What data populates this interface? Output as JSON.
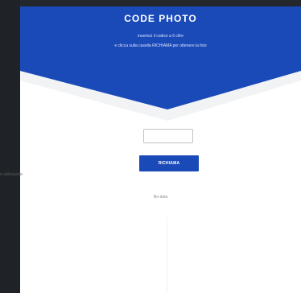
{
  "header": {
    "title": "CODE PHOTO",
    "instruction_line1": "inserisci il codice a 6 cifre",
    "instruction_line2": "e clicca sulla casella RICHIAMA per ottenere la foto"
  },
  "form": {
    "code_value": "",
    "submit_label": "RICHIAMA"
  },
  "status": {
    "text": "No data"
  },
  "side_caption": "e utilizzando",
  "colors": {
    "hero_blue": "#1a49b8",
    "button_blue": "#1a49b8",
    "background_dark": "#24272b",
    "page_white": "#ffffff"
  }
}
